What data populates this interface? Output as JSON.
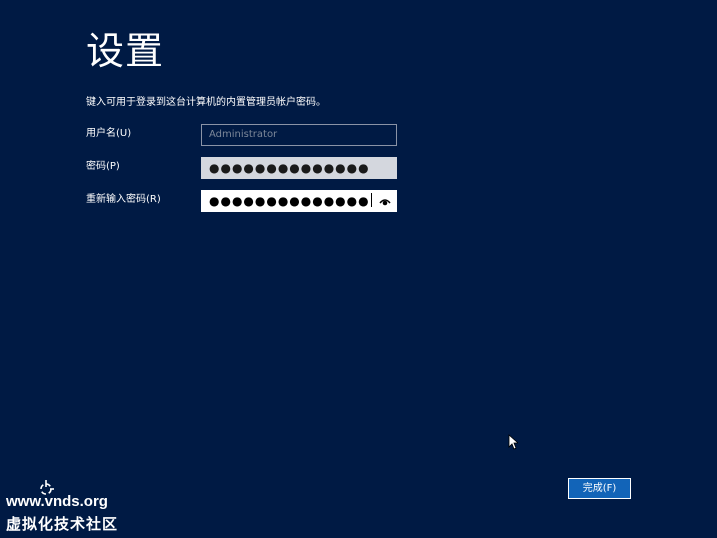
{
  "page": {
    "title": "设置",
    "instructions": "键入可用于登录到这台计算机的内置管理员帐户密码。"
  },
  "form": {
    "username": {
      "label": "用户名(U)",
      "value": "Administrator"
    },
    "password": {
      "label": "密码(P)",
      "masked_value": "●●●●●●●●●●●●●●"
    },
    "confirm_password": {
      "label": "重新输入密码(R)",
      "masked_value": "●●●●●●●●●●●●●●",
      "reveal_icon": "eye-icon"
    }
  },
  "footer": {
    "finish_label": "完成(F)"
  },
  "watermark": {
    "url": "www.vnds.org",
    "name": "虚拟化技术社区",
    "logo_icon": "crosshair-logo-icon"
  },
  "colors": {
    "background": "#001a44",
    "button": "#1264b8",
    "disabled_field_border": "#8a93a6",
    "filled_field_bg": "#d4d7de"
  }
}
